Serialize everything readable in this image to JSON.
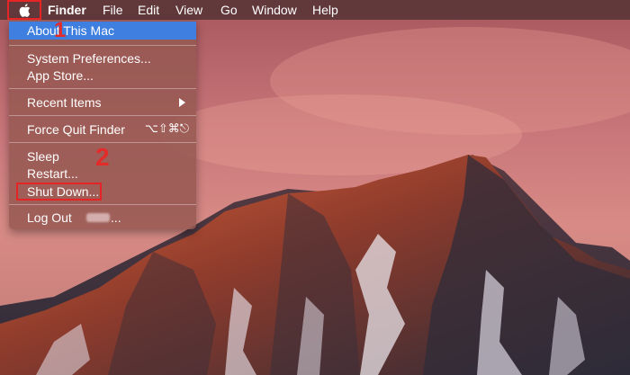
{
  "menubar": {
    "apple_icon": "apple-logo-icon",
    "items": [
      "Finder",
      "File",
      "Edit",
      "View",
      "Go",
      "Window",
      "Help"
    ]
  },
  "apple_menu": {
    "items": [
      {
        "label": "About This Mac",
        "highlighted": true
      },
      {
        "label": "System Preferences..."
      },
      {
        "label": "App Store..."
      },
      {
        "label": "Recent Items",
        "submenu_icon": "triangle-right-icon"
      },
      {
        "label": "Force Quit Finder",
        "shortcut": "⌥⇧⌘⎋"
      },
      {
        "label": "Sleep"
      },
      {
        "label": "Restart..."
      },
      {
        "label": "Shut Down..."
      },
      {
        "label": "Log Out",
        "suffix": "..."
      }
    ]
  },
  "annotations": {
    "step1": "1",
    "step2": "2",
    "color": "#e52525"
  },
  "colors": {
    "highlight": "#3e7fe0",
    "menu_bg": "#965852"
  }
}
